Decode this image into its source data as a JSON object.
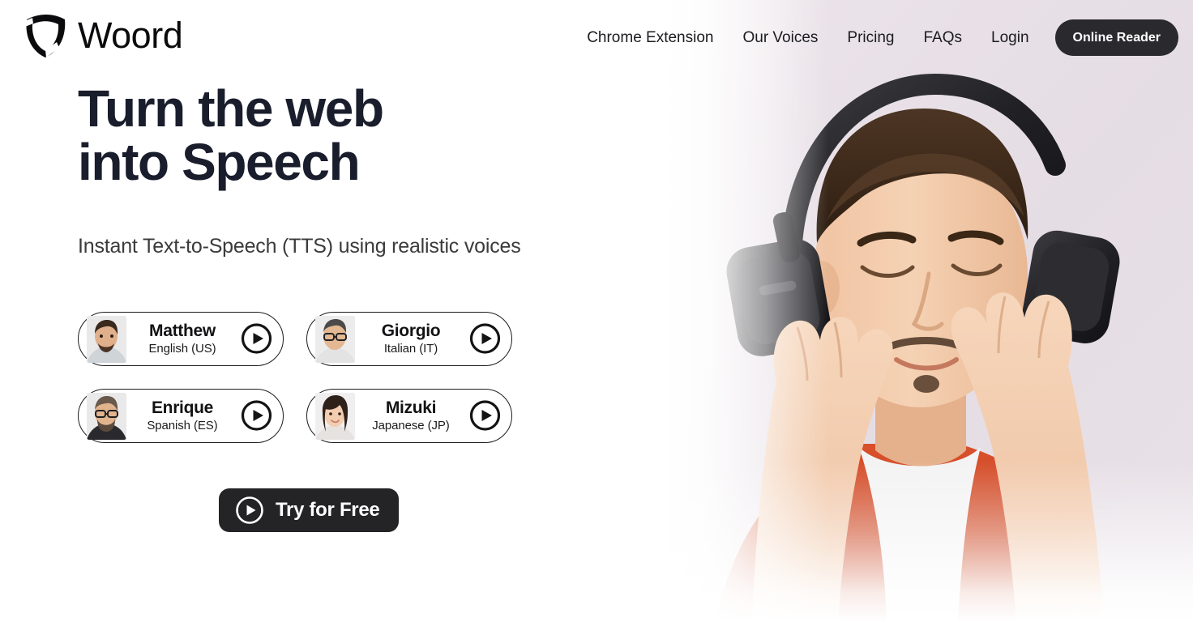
{
  "brand": {
    "name": "Woord",
    "logo_icon": "shield-logo-icon"
  },
  "nav": {
    "links": [
      {
        "label": "Chrome Extension",
        "name": "nav-chrome-extension"
      },
      {
        "label": "Our Voices",
        "name": "nav-our-voices"
      },
      {
        "label": "Pricing",
        "name": "nav-pricing"
      },
      {
        "label": "FAQs",
        "name": "nav-faqs"
      },
      {
        "label": "Login",
        "name": "nav-login"
      }
    ],
    "cta": {
      "label": "Online Reader",
      "bg": "#2a2a2e",
      "color": "#ffffff"
    }
  },
  "hero": {
    "headline": "Turn the web into Speech",
    "subtitle": "Instant Text-to-Speech (TTS) using realistic voices",
    "headline_color": "#191d2c",
    "subtitle_color": "#3b3b3d",
    "image_bg": "#e7e0e6",
    "image_alt": "man-with-headphones-photo"
  },
  "voices": [
    {
      "name": "Matthew",
      "language": "English (US)",
      "play_icon": "play-icon",
      "avatar": "avatar-matthew"
    },
    {
      "name": "Giorgio",
      "language": "Italian (IT)",
      "play_icon": "play-icon",
      "avatar": "avatar-giorgio"
    },
    {
      "name": "Enrique",
      "language": "Spanish (ES)",
      "play_icon": "play-icon",
      "avatar": "avatar-enrique"
    },
    {
      "name": "Mizuki",
      "language": "Japanese (JP)",
      "play_icon": "play-icon",
      "avatar": "avatar-mizuki"
    }
  ],
  "cta": {
    "label": "Try for Free",
    "icon": "play-icon",
    "bg": "#242427",
    "color": "#ffffff"
  }
}
